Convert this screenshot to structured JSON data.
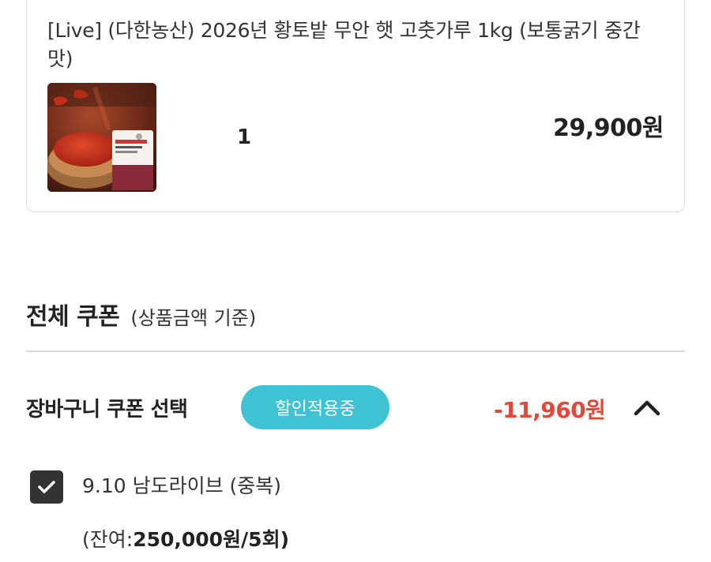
{
  "product": {
    "title": "[Live] (다한농산) 2026년 황토밭 무안 햇 고춧가루 1kg (보통굵기 중간맛)",
    "quantity": "1",
    "price": "29,900원"
  },
  "coupon_section": {
    "title": "전체 쿠폰",
    "subtitle": "(상품금액 기준)",
    "row": {
      "label": "장바구니 쿠폰 선택",
      "badge": "할인적용중",
      "discount": "-11,960원"
    },
    "items": [
      {
        "checked": true,
        "name": "9.10 남도라이브 (중복)",
        "remaining_prefix": "(잔여:",
        "remaining_value": "250,000원/5회)"
      }
    ]
  },
  "colors": {
    "badge": "#3fc3d4",
    "discount": "#e2483a",
    "checkbox": "#333333"
  },
  "icons": {
    "chevron": "chevron-up-icon",
    "check": "check-icon"
  }
}
